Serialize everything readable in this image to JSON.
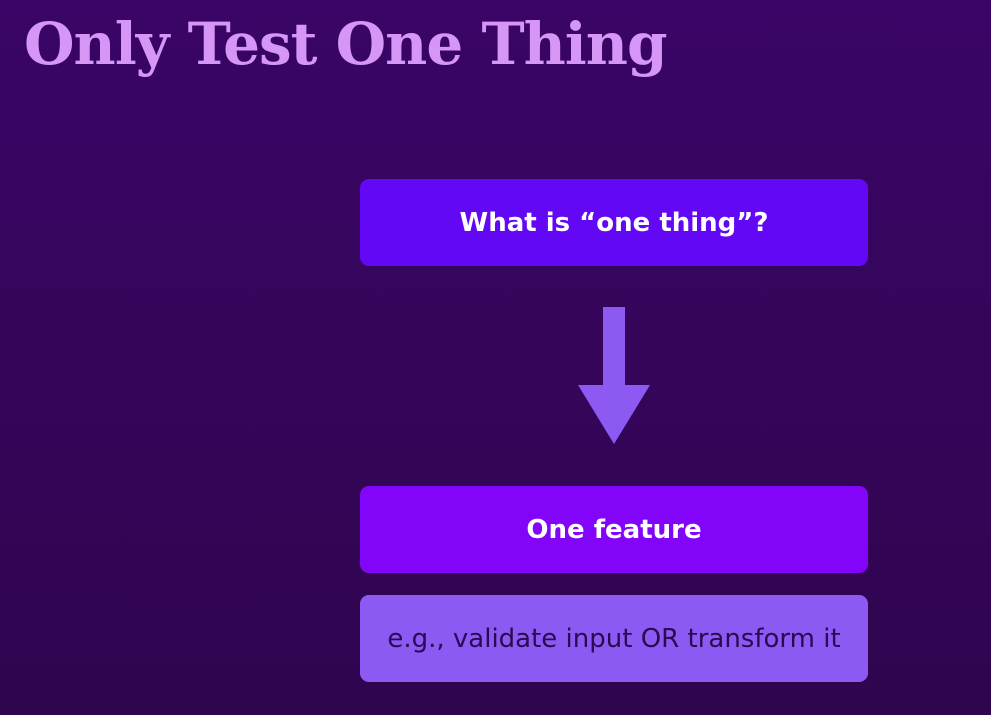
{
  "slide": {
    "title": "Only Test One Thing"
  },
  "diagram": {
    "question": "What is “one thing”?",
    "answer": "One feature",
    "example": "e.g., validate input OR transform it",
    "arrow_icon": "arrow-down-icon"
  },
  "colors": {
    "title": "#d596f5",
    "question_box": "#6208f5",
    "answer_box": "#8205fa",
    "example_box": "#8d59f3",
    "arrow": "#8d59f3"
  }
}
